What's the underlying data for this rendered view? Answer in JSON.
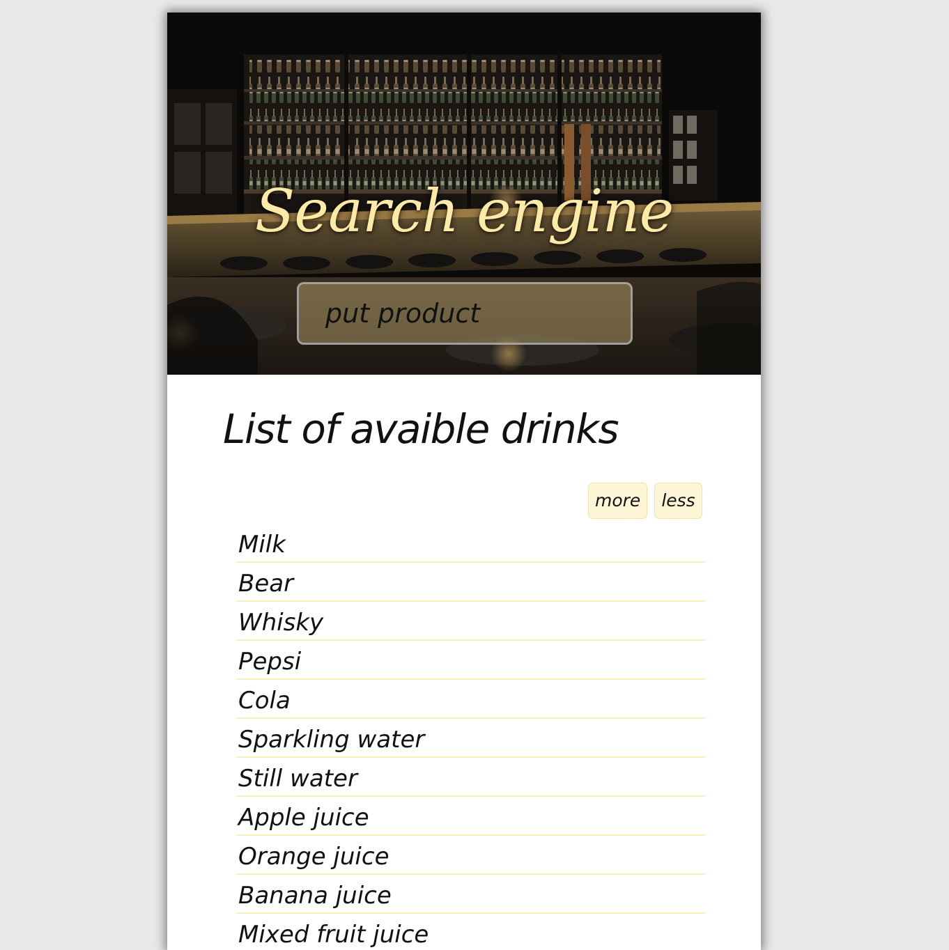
{
  "hero": {
    "title": "Search engine",
    "background_icon": "bar-interior-photo",
    "title_color": "#fdeaa6"
  },
  "search": {
    "placeholder": "put product",
    "value": ""
  },
  "list": {
    "title": "List of avaible drinks",
    "more_label": "more",
    "less_label": "less",
    "items": [
      "Milk",
      "Bear",
      "Whisky",
      "Pepsi",
      "Cola",
      "Sparkling water",
      "Still water",
      "Apple juice",
      "Orange juice",
      "Banana juice",
      "Mixed fruit juice"
    ]
  },
  "colors": {
    "button_bg": "#fdf5d6",
    "row_divider": "#fbeeb8",
    "page_bg": "#e8e8e8"
  }
}
